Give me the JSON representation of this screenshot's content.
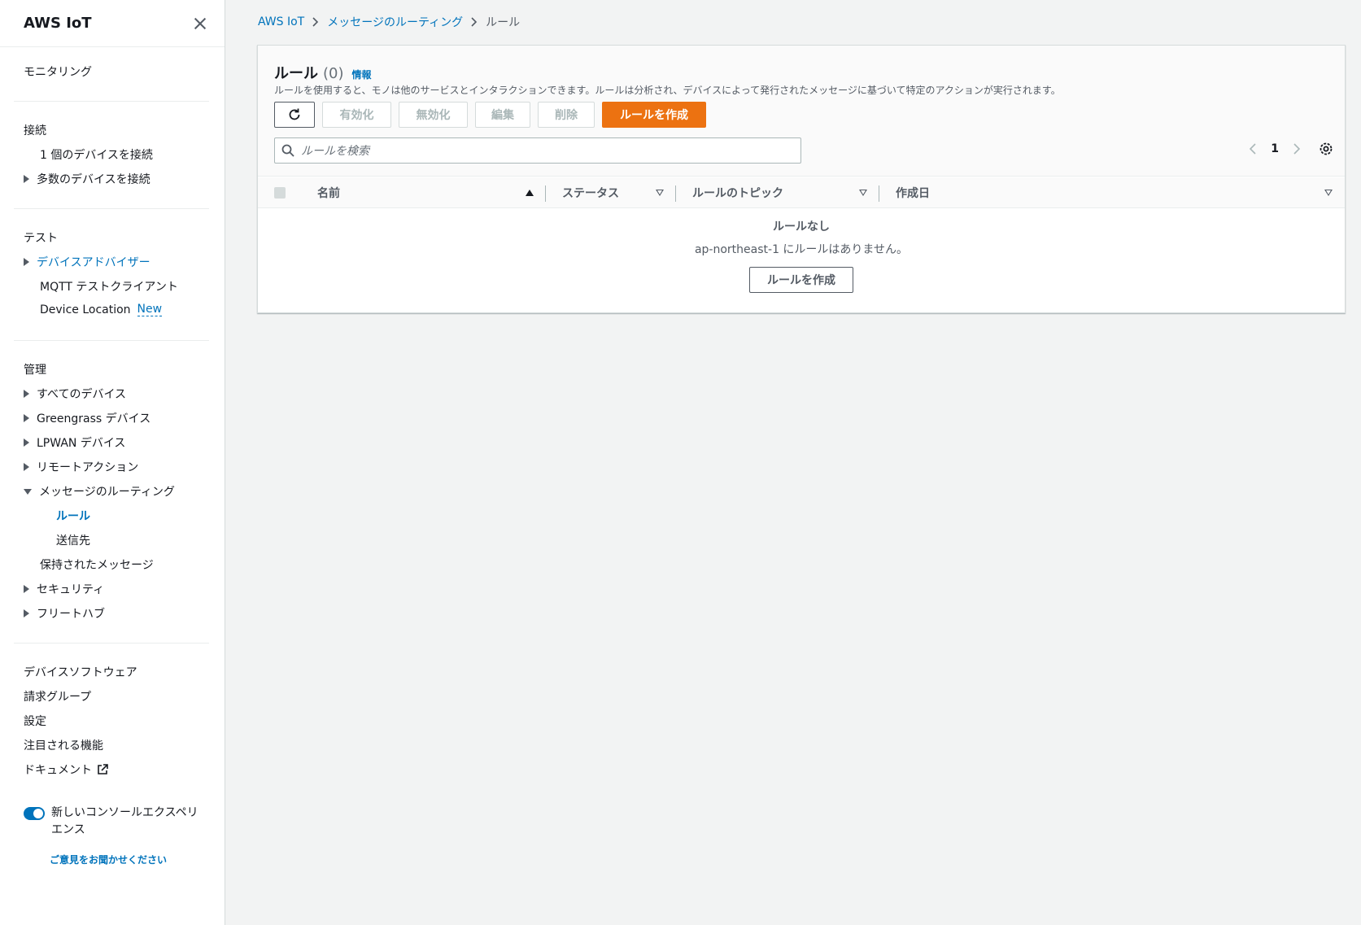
{
  "sidebar": {
    "title": "AWS IoT",
    "monitoring": "モニタリング",
    "connect": {
      "heading": "接続",
      "items": [
        "1 個のデバイスを接続",
        "多数のデバイスを接続"
      ]
    },
    "test": {
      "heading": "テスト",
      "items": [
        "デバイスアドバイザー",
        "MQTT テストクライアント",
        "Device Location"
      ],
      "new_badge": "New"
    },
    "manage": {
      "heading": "管理",
      "items": [
        "すべてのデバイス",
        "Greengrass デバイス",
        "LPWAN デバイス",
        "リモートアクション",
        "メッセージのルーティング"
      ],
      "routing_children": [
        "ルール",
        "送信先"
      ],
      "more": [
        "保持されたメッセージ",
        "セキュリティ",
        "フリートハブ"
      ]
    },
    "bottom": [
      "デバイスソフトウェア",
      "請求グループ",
      "設定",
      "注目される機能",
      "ドキュメント"
    ],
    "toggle_label_1": "新しいコンソールエクスペリ",
    "toggle_label_2": "エンス",
    "feedback": "ご意見をお聞かせください"
  },
  "breadcrumb": {
    "root": "AWS IoT",
    "parent": "メッセージのルーティング",
    "current": "ルール"
  },
  "panel": {
    "title": "ルール",
    "count": "(0)",
    "info": "情報",
    "description": "ルールを使用すると、モノは他のサービスとインタラクションできます。ルールは分析され、デバイスによって発行されたメッセージに基づいて特定のアクションが実行されます。",
    "buttons": {
      "enable": "有効化",
      "disable": "無効化",
      "edit": "編集",
      "delete": "削除",
      "create": "ルールを作成"
    },
    "search_placeholder": "ルールを検索",
    "page": "1",
    "columns": [
      "名前",
      "ステータス",
      "ルールのトピック",
      "作成日"
    ],
    "empty": {
      "title": "ルールなし",
      "description": "ap-northeast-1 にルールはありません。",
      "button": "ルールを作成"
    }
  },
  "colors": {
    "accent": "#0073bb",
    "primary_button": "#ec7211"
  }
}
